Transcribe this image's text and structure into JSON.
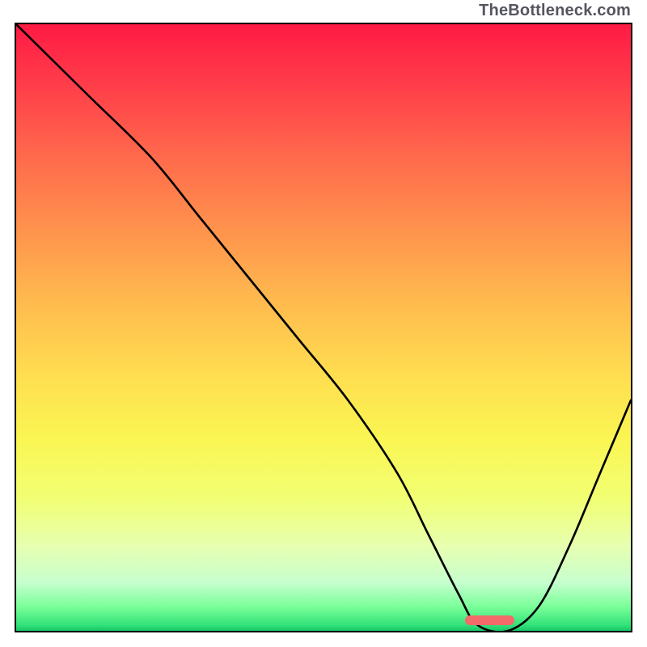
{
  "watermark": "TheBottleneck.com",
  "chart_data": {
    "type": "line",
    "title": "",
    "xlabel": "",
    "ylabel": "",
    "xlim": [
      0,
      100
    ],
    "ylim": [
      0,
      100
    ],
    "grid": false,
    "legend": false,
    "colors": {
      "curve": "#000000",
      "marker": "#f46a6a",
      "gradient_top": "#ff1a44",
      "gradient_bottom": "#18c766"
    },
    "series": [
      {
        "name": "bottleneck-curve",
        "x": [
          0,
          6,
          12,
          22,
          30,
          38,
          46,
          54,
          62,
          67,
          72,
          75,
          80,
          85,
          90,
          95,
          100
        ],
        "y": [
          100,
          94,
          88,
          78,
          68,
          58,
          48,
          38,
          26,
          16,
          6,
          1,
          0,
          4,
          14,
          26,
          38
        ]
      }
    ],
    "marker": {
      "x_start": 73,
      "x_end": 81,
      "y": 1,
      "height": 1.6
    }
  }
}
